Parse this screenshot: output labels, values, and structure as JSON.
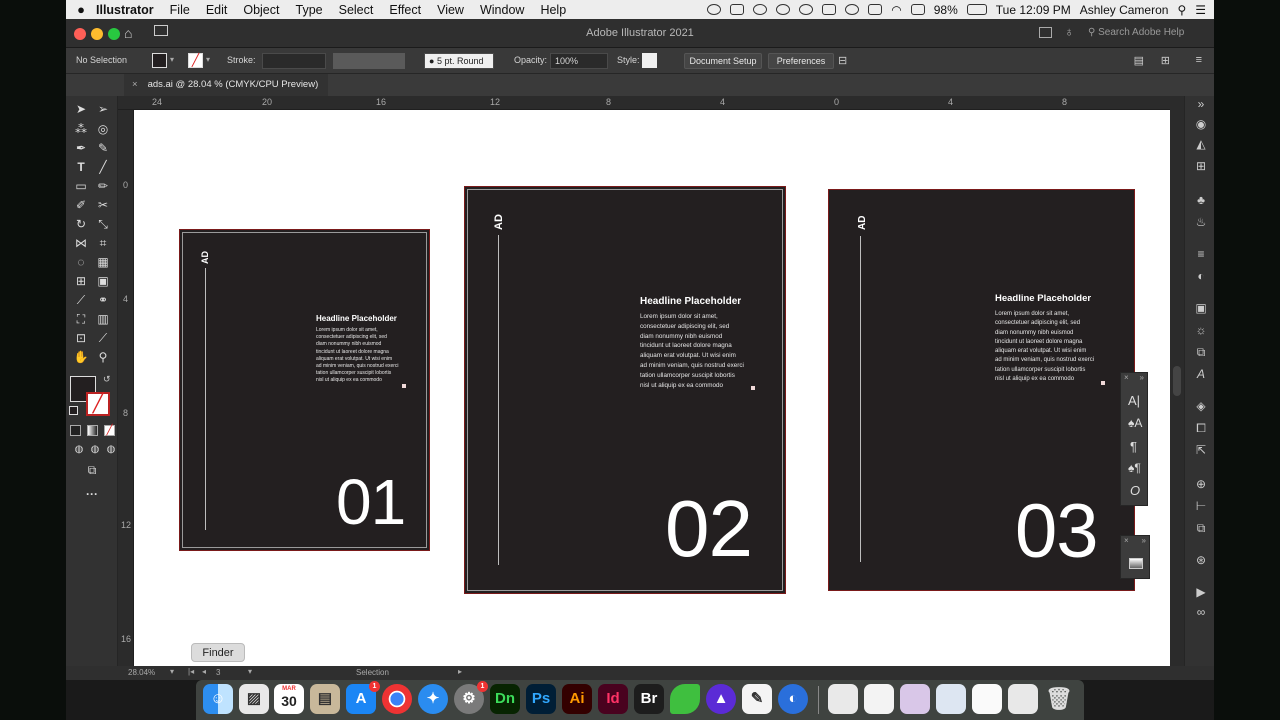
{
  "menubar": {
    "app_name": "Illustrator",
    "items": [
      "File",
      "Edit",
      "Object",
      "Type",
      "Select",
      "Effect",
      "View",
      "Window",
      "Help"
    ],
    "battery": "98%",
    "clock": "Tue 12:09 PM",
    "user": "Ashley Cameron"
  },
  "window": {
    "title": "Adobe Illustrator 2021",
    "search_placeholder": "Search Adobe Help"
  },
  "control": {
    "selection": "No Selection",
    "stroke_label": "Stroke:",
    "brush": "5 pt. Round",
    "opacity_label": "Opacity:",
    "opacity_value": "100%",
    "style_label": "Style:",
    "document_setup": "Document Setup",
    "preferences": "Preferences"
  },
  "tab": {
    "close": "×",
    "label": "ads.ai @ 28.04 % (CMYK/CPU Preview)"
  },
  "ruler": {
    "top": [
      "24",
      "20",
      "16",
      "12",
      "8",
      "4",
      "0",
      "4",
      "8"
    ],
    "left": [
      "0",
      "4",
      "8",
      "12",
      "16"
    ]
  },
  "artboards": [
    {
      "tag": "AD",
      "headline": "Headline Placeholder",
      "body": [
        "Lorem ipsum dolor sit amet,",
        "consectetuer adipiscing elit, sed",
        "diam nonummy nibh euismod",
        "tincidunt ut laoreet dolore magna",
        "aliquam erat volutpat. Ut wisi enim",
        "ad minim veniam, quis nostrud exerci",
        "tation ullamcorper suscipit lobortis",
        "nisl ut aliquip ex ea commodo"
      ],
      "number": "01"
    },
    {
      "tag": "AD",
      "headline": "Headline Placeholder",
      "body": [
        "Lorem ipsum dolor sit amet,",
        "consectetuer adipiscing elit, sed",
        "diam nonummy nibh euismod",
        "tincidunt ut laoreet dolore magna",
        "aliquam erat volutpat. Ut wisi enim",
        "ad minim veniam, quis nostrud exerci",
        "tation ullamcorper suscipit lobortis",
        "nisl ut aliquip ex ea commodo"
      ],
      "number": "02"
    },
    {
      "tag": "AD",
      "headline": "Headline Placeholder",
      "body": [
        "Lorem ipsum dolor sit amet,",
        "consectetuer adipiscing elit, sed",
        "diam nonummy nibh euismod",
        "tincidunt ut laoreet dolore magna",
        "aliquam erat volutpat. Ut wisi enim",
        "ad minim veniam, quis nostrud exerci",
        "tation ullamcorper suscipit lobortis",
        "nisl ut aliquip ex ea commodo"
      ],
      "number": "03"
    }
  ],
  "statusbar": {
    "zoom": "28.04%",
    "artboard_index": "3",
    "tool": "Selection"
  },
  "tooltip": "Finder",
  "dock": {
    "calendar_month": "MAR",
    "calendar_day": "30",
    "app_store_badge": "1",
    "prefs_badge": "1",
    "dn": "Dn",
    "ps": "Ps",
    "ai": "Ai",
    "id": "Id",
    "br": "Br"
  },
  "colors": {
    "artboard_fill": "#231f20",
    "artboard_border": "#7a1a1a",
    "ui_dark": "#323232"
  }
}
